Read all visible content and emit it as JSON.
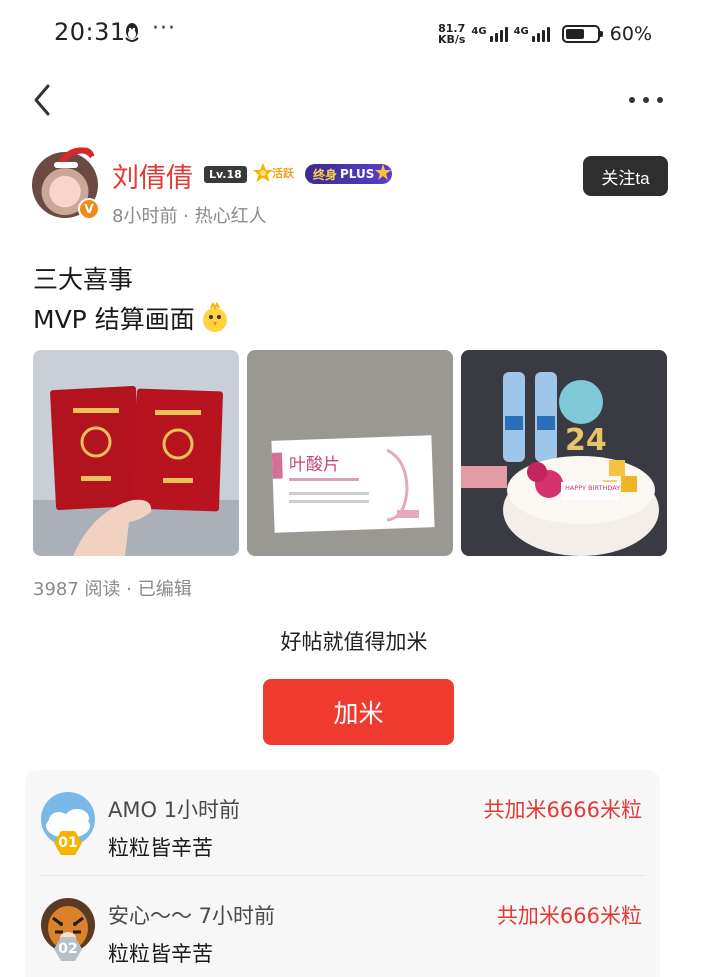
{
  "status_bar": {
    "time": "20:31",
    "more_dots": "···",
    "speed_value": "81.7",
    "speed_unit": "KB/s",
    "network_1": "4G",
    "network_2": "4G",
    "battery_percent": "60%",
    "battery_level": 0.6
  },
  "author": {
    "name": "刘倩倩",
    "level": "Lv.18",
    "active_label": "活跃",
    "plus_label_prefix": "终身",
    "plus_label": "PLUS",
    "verified_mark": "V",
    "meta": "8小时前 · 热心红人",
    "follow_label": "关注ta"
  },
  "post": {
    "line1": "三大喜事",
    "line2": "MVP 结算画面",
    "photo2_text": "叶酸片",
    "photo3_text": "24",
    "photo3_banner": "HAPPY BIRTHDAY",
    "stats": "3987 阅读 · 已编辑"
  },
  "reward": {
    "prompt": "好帖就值得加米",
    "button_label": "加米",
    "items": [
      {
        "rank": "01",
        "name": "AMO 1小时前",
        "message": "粒粒皆辛苦",
        "amount": "共加米6666米粒"
      },
      {
        "rank": "02",
        "name": "安心～～ 7小时前",
        "message": "粒粒皆辛苦",
        "amount": "共加米666米粒"
      }
    ]
  },
  "colors": {
    "accent_red": "#ee3a2f",
    "name_red": "#e53935",
    "follow_bg": "#2e2e2e",
    "meta_gray": "#8a8a8a"
  }
}
